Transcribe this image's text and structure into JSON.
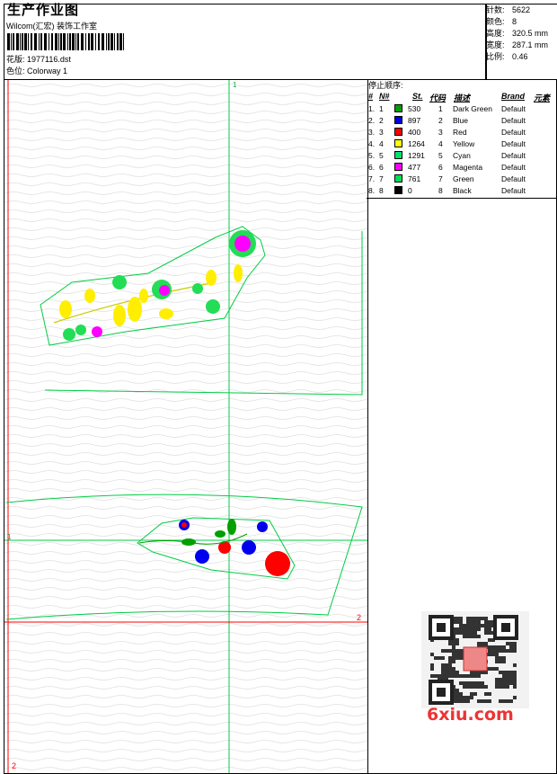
{
  "header": {
    "title": "生产作业图",
    "company": "Wilcom(汇宏) 装饰工作室",
    "design_label": "花版: 1977116.dst",
    "colorway_label": "色位:  Colorway 1"
  },
  "stats": [
    {
      "label": "针数:",
      "value": "5622"
    },
    {
      "label": "颜色:",
      "value": "8"
    },
    {
      "label": "高度:",
      "value": "320.5 mm"
    },
    {
      "label": "宽度:",
      "value": "287.1 mm"
    },
    {
      "label": "比例:",
      "value": "0.46"
    }
  ],
  "legend": {
    "title": "停止顺序:",
    "headers": {
      "num": "#",
      "no": "N#",
      "st": "St.",
      "code": "代码",
      "desc": "描述",
      "brand": "Brand",
      "elem": "元素"
    },
    "rows": [
      {
        "num": "1.",
        "no": "1",
        "st": "530",
        "code": "1",
        "desc": "Dark Green",
        "brand": "Default",
        "color": "#00a000"
      },
      {
        "num": "2.",
        "no": "2",
        "st": "897",
        "code": "2",
        "desc": "Blue",
        "brand": "Default",
        "color": "#0000e0"
      },
      {
        "num": "3.",
        "no": "3",
        "st": "400",
        "code": "3",
        "desc": "Red",
        "brand": "Default",
        "color": "#ff0000"
      },
      {
        "num": "4.",
        "no": "4",
        "st": "1264",
        "code": "4",
        "desc": "Yellow",
        "brand": "Default",
        "color": "#ffff00"
      },
      {
        "num": "5.",
        "no": "5",
        "st": "1291",
        "code": "5",
        "desc": "Cyan",
        "brand": "Default",
        "color": "#00e070"
      },
      {
        "num": "6.",
        "no": "6",
        "st": "477",
        "code": "6",
        "desc": "Magenta",
        "brand": "Default",
        "color": "#ff00ff"
      },
      {
        "num": "7.",
        "no": "7",
        "st": "761",
        "code": "7",
        "desc": "Green",
        "brand": "Default",
        "color": "#00dd55"
      },
      {
        "num": "8.",
        "no": "8",
        "st": "0",
        "code": "8",
        "desc": "Black",
        "brand": "Default",
        "color": "#000000"
      }
    ]
  },
  "canvas": {
    "markers": {
      "top_guide": "1",
      "left_guide": "1",
      "right_red": "2",
      "bottom_red": "2"
    },
    "colors": {
      "guide": "#00cc44",
      "red_axis": "#ff0000"
    }
  },
  "watermark": {
    "text": "6xiu.com",
    "qr_center": "双溪图库"
  }
}
